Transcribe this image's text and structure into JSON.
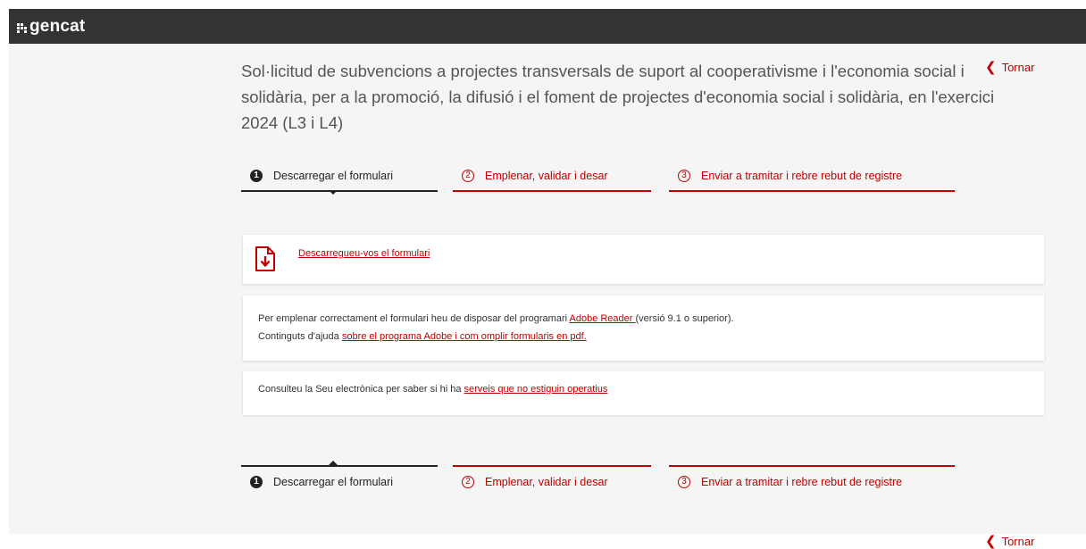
{
  "brand": {
    "logo_text": "gencat"
  },
  "colors": {
    "accent": "#c00000",
    "topbar": "#333333",
    "background": "#f5f5f5"
  },
  "page": {
    "title": "Sol·licitud de subvencions a projectes transversals de suport al cooperativisme i l'economia social i solidària, per a la promoció, la difusió i el foment de projectes d'economia social i solidària, en l'exercici 2024 (L3 i L4)",
    "back_label": "Tornar"
  },
  "steps": [
    {
      "number": "1",
      "label": "Descarregar el formulari",
      "state": "active"
    },
    {
      "number": "2",
      "label": "Emplenar, validar i desar",
      "state": "pending"
    },
    {
      "number": "3",
      "label": "Enviar a tramitar i rebre rebut de registre",
      "state": "pending"
    }
  ],
  "download": {
    "icon": "file-download-icon",
    "link_text": "Descarregueu-vos el formulari"
  },
  "info": {
    "line1_prefix": "Per emplenar correctament el formulari heu de disposar del programari ",
    "line1_link": "Adobe Reader ",
    "line1_suffix": "(versió 9.1 o superior).",
    "line2_prefix": "Continguts d'ajuda ",
    "line2_link": "sobre el programa Adobe i com omplir formularis en pdf."
  },
  "notice": {
    "prefix": "Consulteu la Seu electrònica per saber si hi ha ",
    "link": "serveis que no estiguin operatius"
  }
}
